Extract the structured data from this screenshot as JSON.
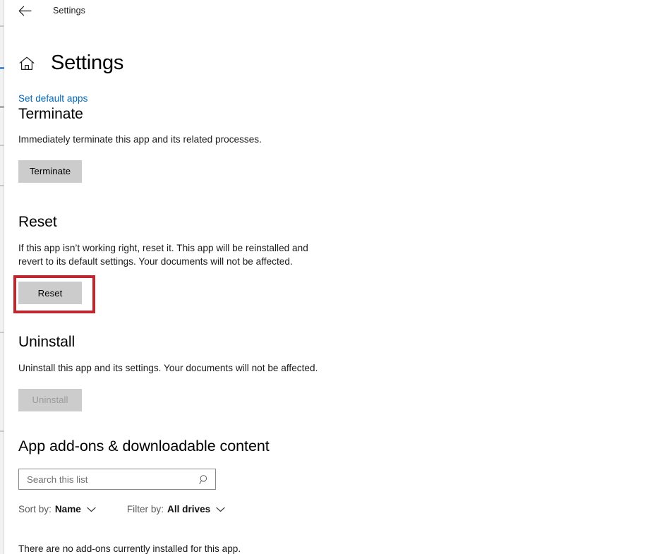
{
  "titlebar": {
    "back_icon": "back-arrow-icon",
    "title": "Settings"
  },
  "page": {
    "home_icon": "home-icon",
    "title": "Settings",
    "default_apps_link": "Set default apps"
  },
  "sections": {
    "terminate": {
      "title": "Terminate",
      "description": "Immediately terminate this app and its related processes.",
      "button_label": "Terminate",
      "button_enabled": true
    },
    "reset": {
      "title": "Reset",
      "description_line1": "If this app isn’t working right, reset it. This app will be reinstalled and",
      "description_line2": "revert to its default settings. Your documents will not be affected.",
      "button_label": "Reset",
      "button_enabled": true,
      "highlight_color": "#c0262e"
    },
    "uninstall": {
      "title": "Uninstall",
      "description": "Uninstall this app and its settings. Your documents will not be affected.",
      "button_label": "Uninstall",
      "button_enabled": false
    },
    "addons": {
      "title": "App add-ons & downloadable content",
      "search_placeholder": "Search this list",
      "search_value": "",
      "search_icon": "search-icon",
      "sort_label": "Sort by:",
      "sort_value": "Name",
      "filter_label": "Filter by:",
      "filter_value": "All drives",
      "chevron_icon": "chevron-down-icon",
      "empty_message": "There are no add-ons currently installed for this app."
    }
  },
  "colors": {
    "accent_link": "#0067b8",
    "button_face": "#cccccc",
    "button_disabled_text": "#9b9b9b",
    "highlight_red": "#c0262e",
    "window_background": "#ffffff"
  }
}
